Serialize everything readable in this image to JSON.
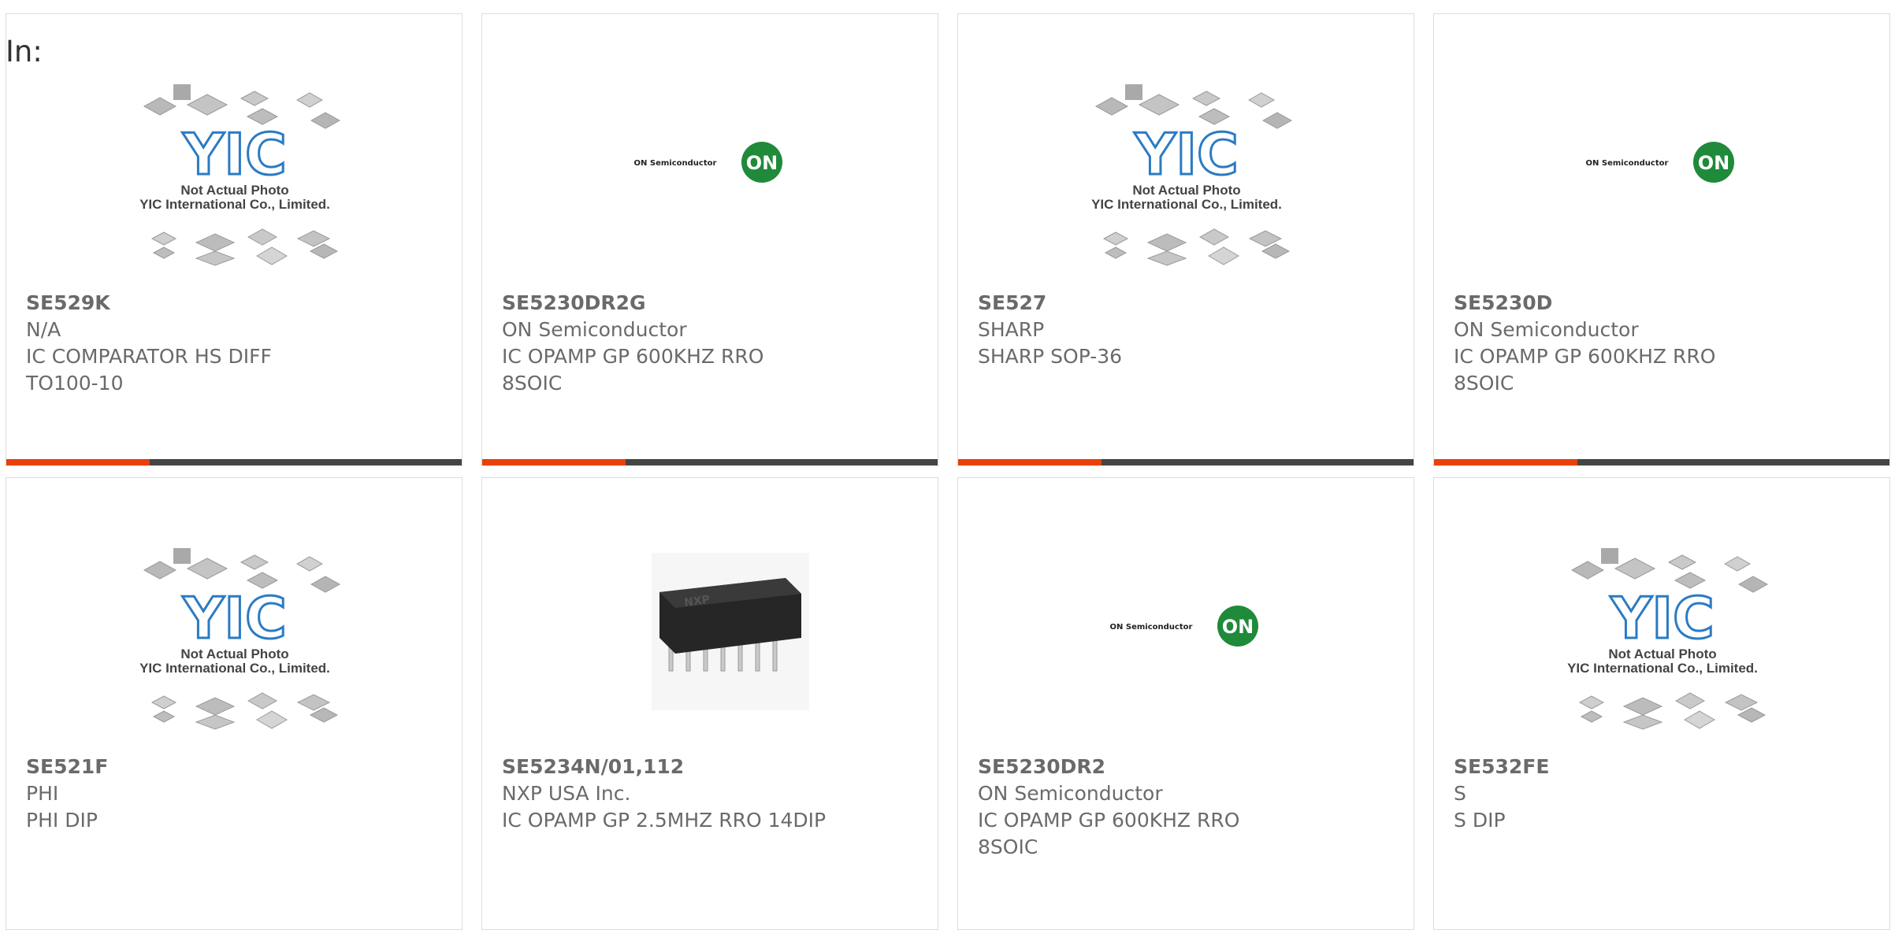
{
  "filter": {
    "label": "In:"
  },
  "products": [
    {
      "part_number": "SE529K",
      "manufacturer": "N/A",
      "lines": [
        "IC COMPARATOR HS DIFF",
        "TO100-10"
      ],
      "image": "yic-placeholder",
      "placeholder_text": [
        "Not Actual Photo",
        "YIC International Co., Limited."
      ]
    },
    {
      "part_number": "SE5230DR2G",
      "manufacturer": "ON Semiconductor",
      "lines": [
        "IC OPAMP GP 600KHZ RRO",
        "8SOIC"
      ],
      "image": "on-semi-logo",
      "logo_text": "ON Semiconductor",
      "logo_badge": "ON"
    },
    {
      "part_number": "SE527",
      "manufacturer": "SHARP",
      "lines": [
        "SHARP SOP-36"
      ],
      "image": "yic-placeholder",
      "placeholder_text": [
        "Not Actual Photo",
        "YIC International Co., Limited."
      ]
    },
    {
      "part_number": "SE5230D",
      "manufacturer": "ON Semiconductor",
      "lines": [
        "IC OPAMP GP 600KHZ RRO",
        "8SOIC"
      ],
      "image": "on-semi-logo",
      "logo_text": "ON Semiconductor",
      "logo_badge": "ON"
    },
    {
      "part_number": "SE521F",
      "manufacturer": "PHI",
      "lines": [
        "PHI DIP"
      ],
      "image": "yic-placeholder",
      "placeholder_text": [
        "Not Actual Photo",
        "YIC International Co., Limited."
      ]
    },
    {
      "part_number": "SE5234N/01,112",
      "manufacturer": "NXP USA Inc.",
      "lines": [
        "IC OPAMP GP 2.5MHZ RRO 14DIP"
      ],
      "image": "dip-14-chip",
      "chip_text": "NXP"
    },
    {
      "part_number": "SE5230DR2",
      "manufacturer": "ON Semiconductor",
      "lines": [
        "IC OPAMP GP 600KHZ RRO",
        "8SOIC"
      ],
      "image": "on-semi-logo",
      "logo_text": "ON Semiconductor",
      "logo_badge": "ON"
    },
    {
      "part_number": "SE532FE",
      "manufacturer": "S",
      "lines": [
        "S DIP"
      ],
      "image": "yic-placeholder",
      "placeholder_text": [
        "Not Actual Photo",
        "YIC International Co., Limited."
      ]
    }
  ],
  "colors": {
    "accent": "#e8400a",
    "bar": "#444444",
    "text": "#6a6a6a",
    "on_logo_green": "#1f8a3a",
    "yic_blue": "#2a7bc4"
  }
}
